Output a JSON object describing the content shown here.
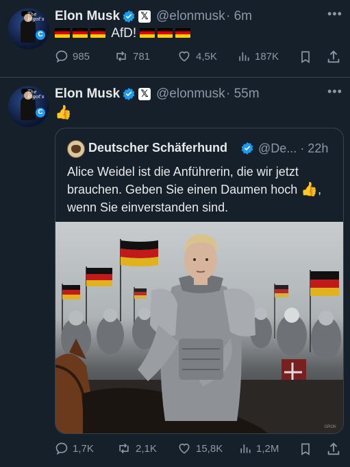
{
  "tweets": [
    {
      "name": "Elon Musk",
      "handle": "@elonmusk",
      "time": "· 6m",
      "text": "AfD!",
      "stats": {
        "replies": "985",
        "reposts": "781",
        "likes": "4,5K",
        "views": "187K"
      }
    },
    {
      "name": "Elon Musk",
      "handle": "@elonmusk",
      "time": "· 55m",
      "text_emoji": "👍",
      "quote": {
        "name": "Deutscher Schäferhund",
        "handle": "@De...",
        "time": "· 22h",
        "text_part1": "Alice Weidel ist die Anführerin, die wir jetzt brauchen. Geben Sie einen Daumen hoch",
        "text_emoji": "👍",
        "text_part2": ", wenn Sie einverstanden sind.",
        "image_watermark": "GROK"
      },
      "stats": {
        "replies": "1,7K",
        "reposts": "2,1K",
        "likes": "15,8K",
        "views": "1,2M"
      }
    }
  ],
  "avatar_text": "The Bigot's",
  "colors": {
    "background": "#15202b",
    "verified": "#1d9bf0",
    "muted": "#8b98a5",
    "flag_black": "#000000",
    "flag_red": "#dd0000",
    "flag_gold": "#ffce00"
  },
  "icons": [
    "more-icon",
    "verified-icon",
    "x-icon",
    "reply-icon",
    "repost-icon",
    "like-icon",
    "views-icon",
    "bookmark-icon",
    "share-icon",
    "flag-de-icon"
  ]
}
